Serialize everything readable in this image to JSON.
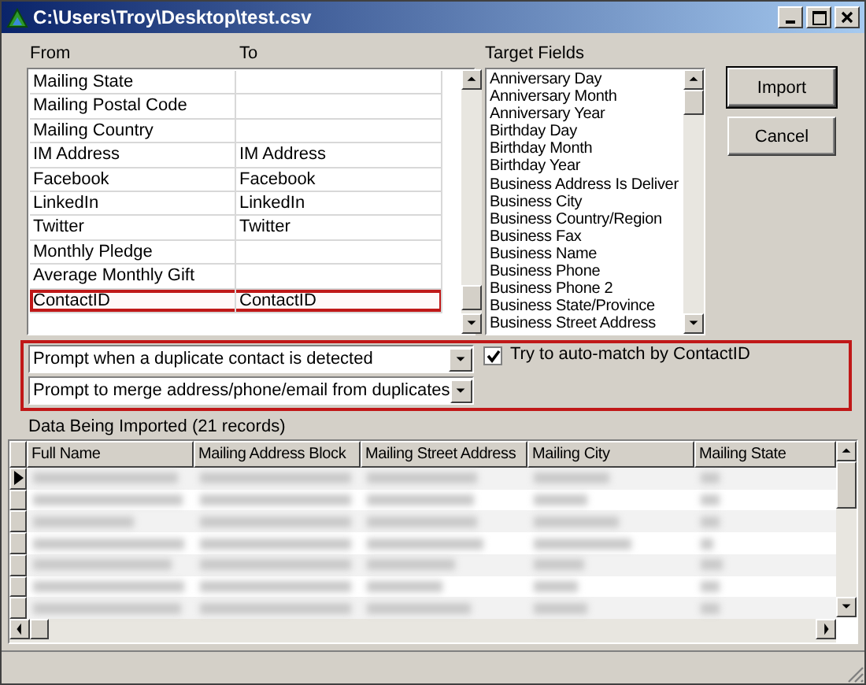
{
  "window": {
    "title": "C:\\Users\\Troy\\Desktop\\test.csv"
  },
  "mapping": {
    "columns": [
      "From",
      "To"
    ],
    "rows": [
      {
        "from": "Mailing State",
        "highlighted": false
      },
      {
        "from": "Mailing Postal Code",
        "highlighted": false
      },
      {
        "from": "Mailing Country",
        "highlighted": false
      },
      {
        "from": "IM Address",
        "to": "IM Address",
        "highlighted": false
      },
      {
        "from": "Facebook",
        "to": "Facebook",
        "highlighted": false
      },
      {
        "from": "LinkedIn",
        "to": "LinkedIn",
        "highlighted": false
      },
      {
        "from": "Twitter",
        "to": "Twitter",
        "highlighted": false
      },
      {
        "from": "Monthly Pledge",
        "highlighted": false
      },
      {
        "from": "Average Monthly Gift",
        "highlighted": false
      },
      {
        "from": "ContactID",
        "to": "ContactID",
        "highlighted": true
      }
    ]
  },
  "target_fields": {
    "label": "Target Fields",
    "items": [
      "Anniversary Day",
      "Anniversary Month",
      "Anniversary Year",
      "Birthday Day",
      "Birthday Month",
      "Birthday Year",
      "Business Address Is Deliver",
      "Business City",
      "Business Country/Region",
      "Business Fax",
      "Business Name",
      "Business Phone",
      "Business Phone 2",
      "Business State/Province",
      "Business Street Address"
    ]
  },
  "buttons": [
    "Import",
    "Cancel"
  ],
  "options": {
    "highlighted": true,
    "dropdowns": [
      "Prompt when a duplicate contact is detected",
      "Prompt to merge address/phone/email from duplicates"
    ],
    "checkbox": {
      "label": "Try to auto-match by ContactID",
      "checked": true
    }
  },
  "data_grid": {
    "label": "Data Being Imported (21 records)",
    "columns": [
      "Full Name",
      "Mailing Address Block",
      "Mailing Street Address",
      "Mailing City",
      "Mailing State"
    ],
    "rows": [
      {
        "selected": true
      },
      {
        "selected": false
      },
      {
        "selected": false
      },
      {
        "selected": false
      },
      {
        "selected": false
      },
      {
        "selected": false
      },
      {
        "selected": false
      }
    ]
  }
}
